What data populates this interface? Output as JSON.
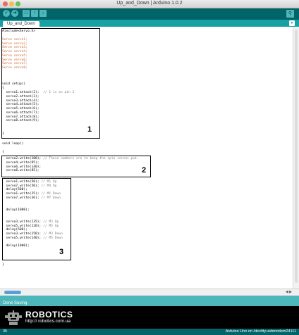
{
  "window": {
    "title": "Up_and_Down | Arduino 1.0.2"
  },
  "toolbar": {
    "verify_icon": "check-icon",
    "upload_icon": "arrow-right-icon",
    "new_icon": "new-file-icon",
    "open_icon": "open-icon",
    "save_icon": "save-icon",
    "serial_icon": "magnifier-icon"
  },
  "tabs": [
    {
      "label": "Up_and_Down"
    }
  ],
  "code": {
    "include": "#include<Servo.h>",
    "decls": [
      "Servo servo1;",
      "Servo servo2;",
      "Servo servo3;",
      "Servo servo4;",
      "Servo servo5;",
      "Servo servo6;",
      "Servo servo7;",
      "Servo servo8;"
    ],
    "setup_sig": "void setup()",
    "open_brace": "{",
    "close_brace": "}",
    "attach_first": "  servo1.attach(2);",
    "attach_first_comment": "  // 1 is on pin 2",
    "attach_rest": [
      "  servo2.attach(3);",
      "  servo3.attach(4);",
      "  servo4.attach(5);",
      "  servo5.attach(6);",
      "  servo6.attach(7);",
      "  servo7.attach(8);",
      "  servo8.attach(9);"
    ],
    "loop_sig": "void loop()",
    "box2_first": "  servo2.write(100);",
    "box2_first_comment": " // These numbers are to keep the spin servos put.",
    "box2_rest": [
      "  servo4.write(95);",
      "  servo6.write(140);",
      "  servo8.write(85);"
    ],
    "box3": [
      {
        "code": "  servo1.write(50);",
        "comment": " // M1 Up"
      },
      {
        "code": "  servo7.write(50);",
        "comment": " // M4 Up"
      },
      {
        "code": "  delay(500);",
        "comment": ""
      },
      {
        "code": "  servo1.write(25);",
        "comment": " // M1 Down"
      },
      {
        "code": "  servo7.write(36);",
        "comment": " // M7 Down"
      },
      {
        "code": "",
        "comment": ""
      },
      {
        "code": "",
        "comment": ""
      },
      {
        "code": "  delay(1000);",
        "comment": ""
      },
      {
        "code": "",
        "comment": ""
      },
      {
        "code": "",
        "comment": ""
      },
      {
        "code": "  servo3.write(135);",
        "comment": " // M3 Up"
      },
      {
        "code": "  servo5.write(120);",
        "comment": " // M5 Up"
      },
      {
        "code": "  delay(500);",
        "comment": ""
      },
      {
        "code": "  servo3.write(150);",
        "comment": " // M3 Down"
      },
      {
        "code": "  servo5.write(140);",
        "comment": " // M5 Down"
      },
      {
        "code": "",
        "comment": ""
      },
      {
        "code": "  delay(1000);",
        "comment": ""
      }
    ]
  },
  "annotations": {
    "box1": "1",
    "box2": "2",
    "box3": "3"
  },
  "status": {
    "message": "Done Saving."
  },
  "watermark": {
    "brand": "ROBOTICS",
    "url": "http:// robotics.com.ua"
  },
  "footer": {
    "line_number": "35",
    "board": "Arduino Uno on /dev/tty.usbmodem24111"
  },
  "colors": {
    "toolbar": "#006468",
    "tabbar": "#17a1a5",
    "accent": "#4db7bb",
    "console": "#000000"
  }
}
